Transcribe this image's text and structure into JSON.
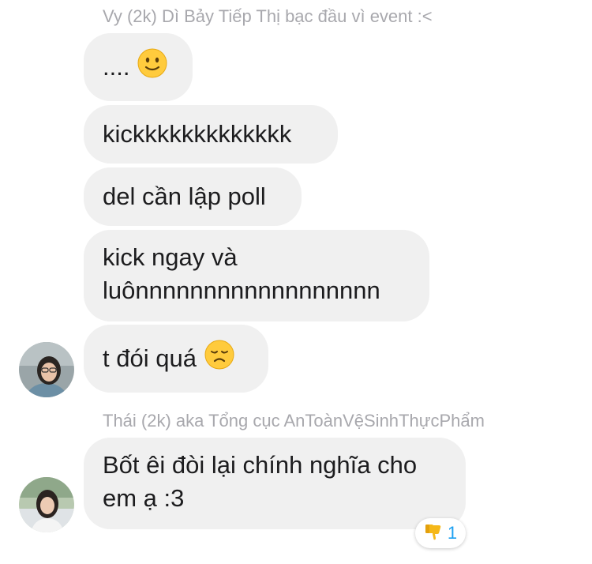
{
  "messages": [
    {
      "sender": "Vy (2k) Dì Bảy Tiếp Thị bạc đầu vì event :<"
    },
    {
      "text": "....",
      "emoji": "slightly-smiling-face-icon"
    },
    {
      "text": "kickkkkkkkkkkkkk"
    },
    {
      "text": "del cần lập poll"
    },
    {
      "line1": "kick ngay và",
      "line2": "luônnnnnnnnnnnnnnnnnn"
    },
    {
      "text": "t đói quá",
      "emoji": "disappointed-face-icon"
    },
    {
      "sender": "Thái (2k) aka Tổng cục AnToànVệSinhThựcPhẩm"
    },
    {
      "line1": "Bốt êi đòi lại chính nghĩa cho",
      "line2": "em ạ :3"
    }
  ],
  "reaction": {
    "icon": "thumbs-down-icon",
    "count": "1"
  },
  "colors": {
    "bubble": "#f0f0f0",
    "sender_text": "#a8a8ad",
    "reaction_count": "#1da1f2"
  }
}
